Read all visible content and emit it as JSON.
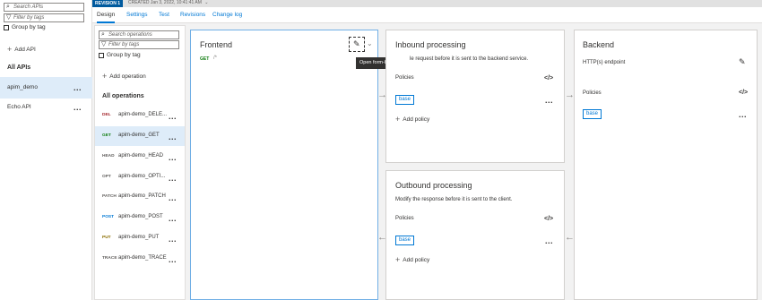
{
  "left_panel": {
    "search_apis_placeholder": "Search APIs",
    "filter_tags_placeholder": "Filter by tags",
    "group_by_tag": "Group by tag",
    "add_api": "Add API",
    "all_apis_heading": "All APIs",
    "apis": [
      {
        "label": "apim_demo",
        "selected": true
      },
      {
        "label": "Echo API",
        "selected": false
      }
    ]
  },
  "revision": {
    "badge": "REVISION 1",
    "created": "CREATED Jan 3, 2022, 10:41:41 AM"
  },
  "tabs": [
    {
      "label": "Design",
      "active": true
    },
    {
      "label": "Settings",
      "active": false
    },
    {
      "label": "Test",
      "active": false
    },
    {
      "label": "Revisions",
      "active": false
    },
    {
      "label": "Change log",
      "active": false
    }
  ],
  "operations_panel": {
    "search_placeholder": "Search operations",
    "filter_placeholder": "Filter by tags",
    "group_by_tag": "Group by tag",
    "add_operation": "Add operation",
    "all_operations_heading": "All operations",
    "operations": [
      {
        "verb": "DEL",
        "name": "apim-demo_DELE...",
        "color": "#a4262c",
        "selected": false
      },
      {
        "verb": "GET",
        "name": "apim-demo_GET",
        "color": "#107c10",
        "selected": true
      },
      {
        "verb": "HEAD",
        "name": "apim-demo_HEAD",
        "color": "#605e5c",
        "selected": false
      },
      {
        "verb": "OPT",
        "name": "apim-demo_OPTI...",
        "color": "#605e5c",
        "selected": false
      },
      {
        "verb": "PATCH",
        "name": "apim-demo_PATCH",
        "color": "#605e5c",
        "selected": false
      },
      {
        "verb": "POST",
        "name": "apim-demo_POST",
        "color": "#0078d4",
        "selected": false
      },
      {
        "verb": "PUT",
        "name": "apim-demo_PUT",
        "color": "#8a6d00",
        "selected": false
      },
      {
        "verb": "TRACE",
        "name": "apim-demo_TRACE",
        "color": "#605e5c",
        "selected": false
      }
    ]
  },
  "frontend": {
    "title": "Frontend",
    "verb": "GET",
    "path": "/*",
    "tooltip": "Open form-based editor"
  },
  "inbound": {
    "title": "Inbound processing",
    "description_visible": "le request before it is sent to the backend service.",
    "policies_label": "Policies",
    "base_chip": "base",
    "add_policy": "Add policy"
  },
  "outbound": {
    "title": "Outbound processing",
    "description": "Modify the response before it is sent to the client.",
    "policies_label": "Policies",
    "base_chip": "base",
    "add_policy": "Add policy"
  },
  "backend": {
    "title": "Backend",
    "endpoint_label": "HTTP(s) endpoint",
    "policies_label": "Policies",
    "base_chip": "base"
  },
  "icons": {
    "code": "</>",
    "more": "...",
    "arrow_right": "→",
    "arrow_left": "←",
    "plus": "+",
    "pencil": "✎"
  }
}
